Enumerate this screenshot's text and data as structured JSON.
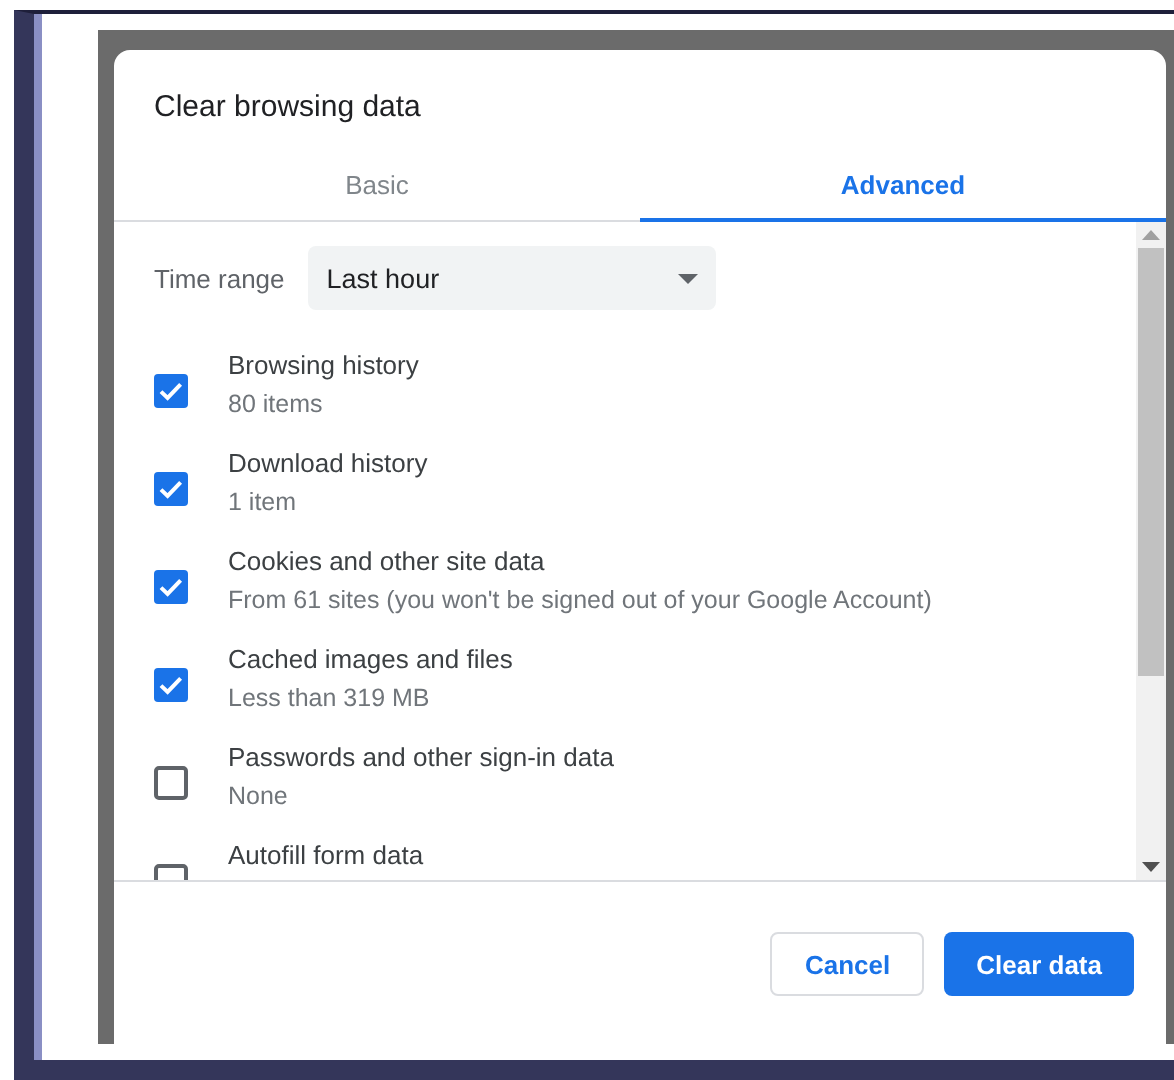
{
  "dialog": {
    "title": "Clear browsing data"
  },
  "tabs": [
    {
      "label": "Basic",
      "selected": false
    },
    {
      "label": "Advanced",
      "selected": true
    }
  ],
  "time_range": {
    "label": "Time range",
    "value": "Last hour"
  },
  "items": [
    {
      "label": "Browsing history",
      "detail": "80 items",
      "checked": true
    },
    {
      "label": "Download history",
      "detail": "1 item",
      "checked": true
    },
    {
      "label": "Cookies and other site data",
      "detail": "From 61 sites (you won't be signed out of your Google Account)",
      "checked": true
    },
    {
      "label": "Cached images and files",
      "detail": "Less than 319 MB",
      "checked": true
    },
    {
      "label": "Passwords and other sign-in data",
      "detail": "None",
      "checked": false
    },
    {
      "label": "Autofill form data",
      "checked": false
    }
  ],
  "buttons": [
    {
      "label": "Cancel",
      "kind": "secondary"
    },
    {
      "label": "Clear data",
      "kind": "primary"
    }
  ]
}
